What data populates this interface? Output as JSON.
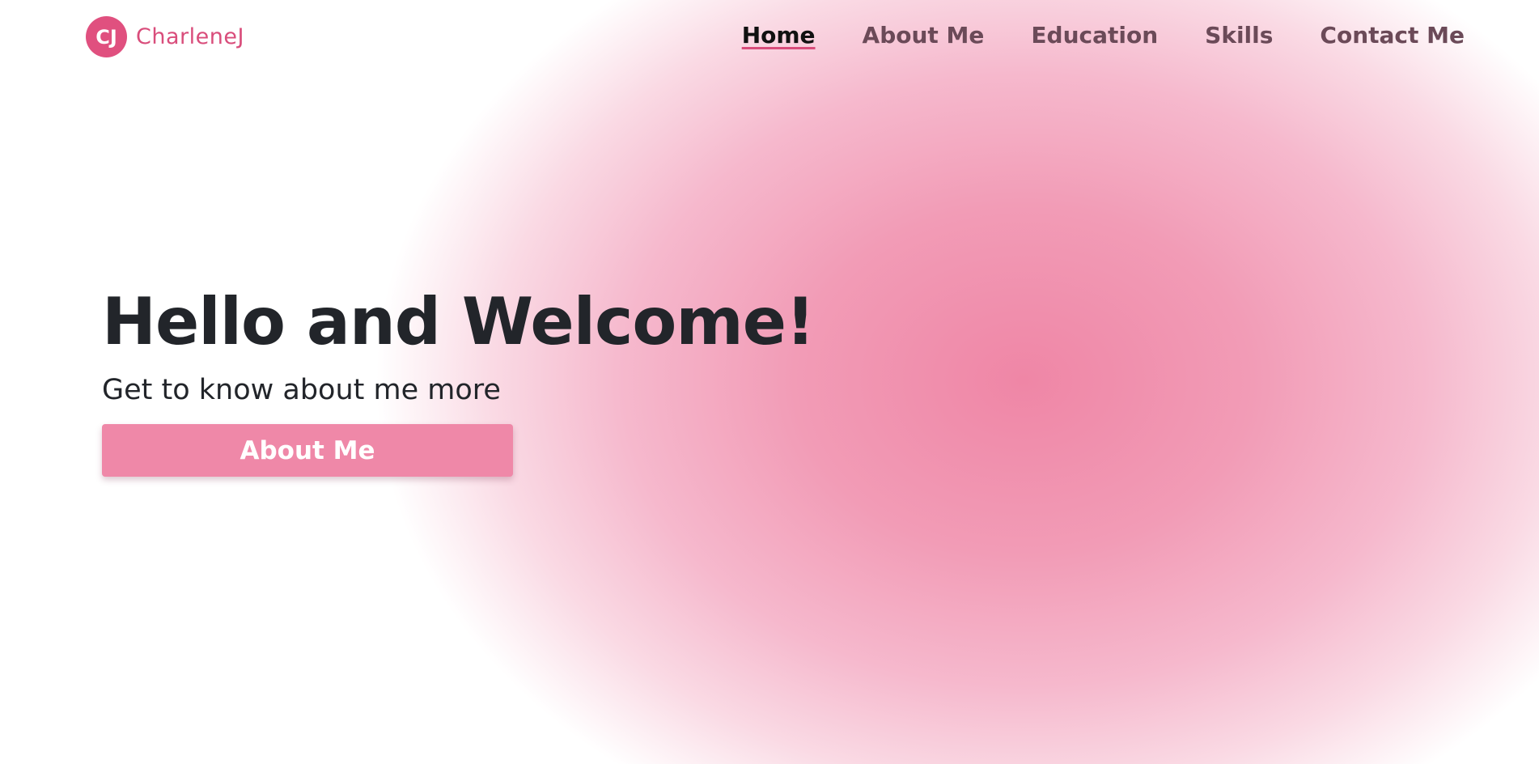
{
  "brand": {
    "initials": "CJ",
    "name": "CharleneJ"
  },
  "nav": {
    "items": [
      {
        "label": "Home",
        "active": true
      },
      {
        "label": "About Me",
        "active": false
      },
      {
        "label": "Education",
        "active": false
      },
      {
        "label": "Skills",
        "active": false
      },
      {
        "label": "Contact Me",
        "active": false
      }
    ]
  },
  "hero": {
    "title": "Hello and Welcome!",
    "subtitle": "Get to know about me more",
    "button_label": "About Me"
  },
  "colors": {
    "brand_accent": "#d94d7b",
    "background_glow": "#ef86a6",
    "button": "#ef88a8",
    "text_dark": "#22252a",
    "nav_text": "#6b4a58"
  }
}
